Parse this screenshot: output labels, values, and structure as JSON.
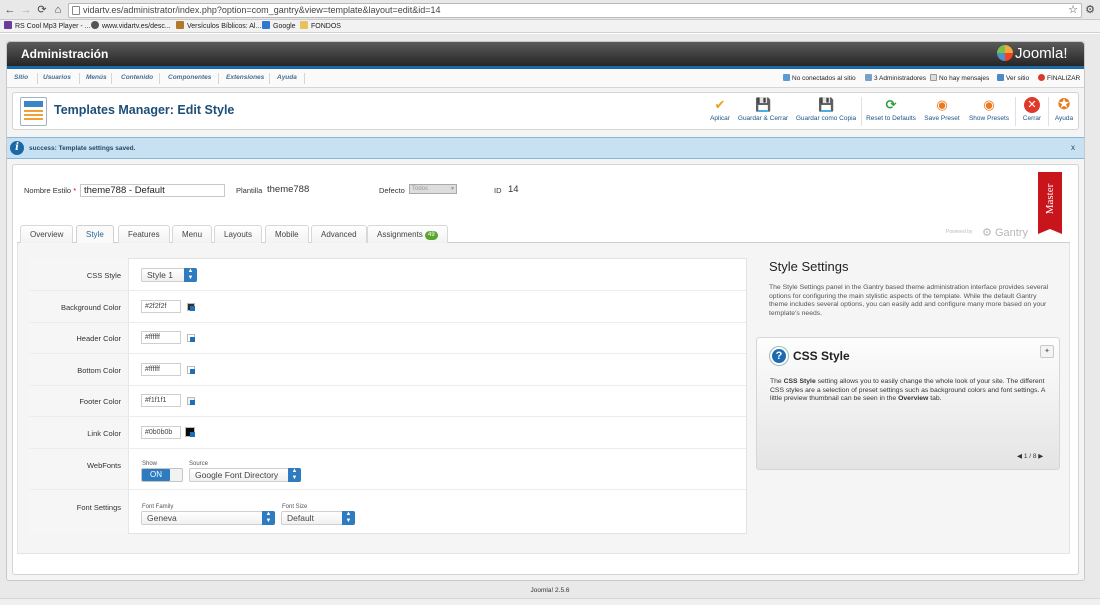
{
  "browser": {
    "url": "vidartv.es/administrator/index.php?option=com_gantry&view=template&layout=edit&id=14",
    "bookmarks": [
      "RS Cool Mp3 Player - ...",
      "www.vidartv.es/desc...",
      "Versículos Bíblicos: Al...",
      "Google",
      "FONDOS"
    ]
  },
  "header": {
    "title": "Administración",
    "logo": "Joomla!"
  },
  "menu": {
    "items": [
      "Sitio",
      "Usuarios",
      "Menús",
      "Contenido",
      "Componentes",
      "Extensiones",
      "Ayuda"
    ],
    "status": [
      "No conectados al sitio",
      "3 Administradores",
      "No hay mensajes",
      "Ver sitio",
      "FINALIZAR"
    ]
  },
  "toolbar": {
    "title": "Templates Manager: Edit Style",
    "buttons": [
      "Aplicar",
      "Guardar & Cerrar",
      "Guardar como Copia",
      "Reset to Defaults",
      "Save Preset",
      "Show Presets",
      "Cerrar",
      "Ayuda"
    ]
  },
  "message": {
    "text": "success: Template settings saved.",
    "close": "x"
  },
  "style_info": {
    "name_label": "Nombre Estilo",
    "name_value": "theme788 - Default",
    "template_label": "Plantilla",
    "template_value": "theme788",
    "default_label": "Defecto",
    "default_value": "Todos",
    "id_label": "ID",
    "id_value": "14",
    "master": "Master"
  },
  "tabs": [
    "Overview",
    "Style",
    "Features",
    "Menu",
    "Layouts",
    "Mobile",
    "Advanced",
    "Assignments"
  ],
  "assignments_count": "49",
  "powered_by": "Powered by",
  "gantry": "Gantry",
  "settings": {
    "css_style": {
      "label": "CSS Style",
      "value": "Style 1"
    },
    "background_color": {
      "label": "Background Color",
      "value": "#2f2f2f"
    },
    "header_color": {
      "label": "Header Color",
      "value": "#ffffff"
    },
    "bottom_color": {
      "label": "Bottom Color",
      "value": "#ffffff"
    },
    "footer_color": {
      "label": "Footer Color",
      "value": "#f1f1f1"
    },
    "link_color": {
      "label": "Link Color",
      "value": "#0b0b0b"
    },
    "webfonts": {
      "label": "WebFonts",
      "show_label": "Show",
      "show_value": "ON",
      "source_label": "Source",
      "source_value": "Google Font Directory"
    },
    "font_settings": {
      "label": "Font Settings",
      "family_label": "Font Family",
      "family_value": "Geneva",
      "size_label": "Font Size",
      "size_value": "Default"
    }
  },
  "style_settings": {
    "title": "Style Settings",
    "description": "The Style Settings panel in the Gantry based theme administration interface provides several options for configuring the main stylistic aspects of the template. While the default Gantry theme includes several options, you can easily add and configure many more based on your template's needs."
  },
  "help": {
    "title": "CSS Style",
    "text_1": "The ",
    "text_bold_1": "CSS Style",
    "text_2": " setting allows you to easily change the whole look of your site. The different CSS styles are a selection of preset settings such as background colors and font settings. A little preview thumbnail can be seen in the ",
    "text_bold_2": "Overview",
    "text_3": " tab.",
    "pager": "1 / 8"
  },
  "footer": "Joomla! 2.5.6",
  "colors": {
    "accent": "#1d6aa8",
    "master": "#c8141b",
    "badge": "#5ba52f"
  }
}
